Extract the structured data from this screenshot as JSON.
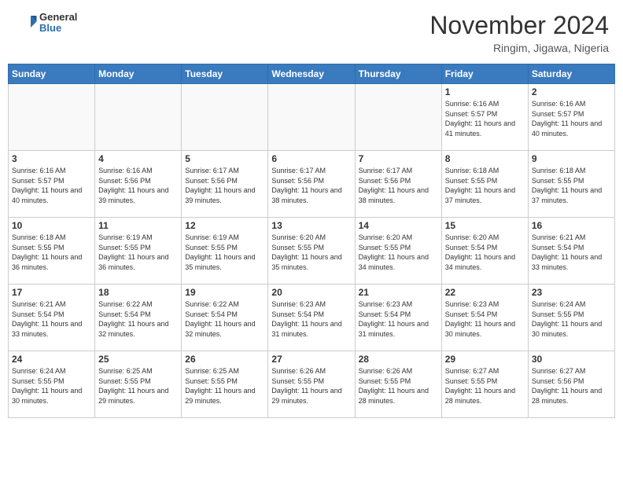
{
  "header": {
    "logo": {
      "general": "General",
      "blue": "Blue"
    },
    "title": "November 2024",
    "location": "Ringim, Jigawa, Nigeria"
  },
  "calendar": {
    "days_of_week": [
      "Sunday",
      "Monday",
      "Tuesday",
      "Wednesday",
      "Thursday",
      "Friday",
      "Saturday"
    ],
    "weeks": [
      [
        {
          "day": "",
          "empty": true
        },
        {
          "day": "",
          "empty": true
        },
        {
          "day": "",
          "empty": true
        },
        {
          "day": "",
          "empty": true
        },
        {
          "day": "",
          "empty": true
        },
        {
          "day": "1",
          "sunrise": "6:16 AM",
          "sunset": "5:57 PM",
          "daylight": "11 hours and 41 minutes."
        },
        {
          "day": "2",
          "sunrise": "6:16 AM",
          "sunset": "5:57 PM",
          "daylight": "11 hours and 40 minutes."
        }
      ],
      [
        {
          "day": "3",
          "sunrise": "6:16 AM",
          "sunset": "5:57 PM",
          "daylight": "11 hours and 40 minutes."
        },
        {
          "day": "4",
          "sunrise": "6:16 AM",
          "sunset": "5:56 PM",
          "daylight": "11 hours and 39 minutes."
        },
        {
          "day": "5",
          "sunrise": "6:17 AM",
          "sunset": "5:56 PM",
          "daylight": "11 hours and 39 minutes."
        },
        {
          "day": "6",
          "sunrise": "6:17 AM",
          "sunset": "5:56 PM",
          "daylight": "11 hours and 38 minutes."
        },
        {
          "day": "7",
          "sunrise": "6:17 AM",
          "sunset": "5:56 PM",
          "daylight": "11 hours and 38 minutes."
        },
        {
          "day": "8",
          "sunrise": "6:18 AM",
          "sunset": "5:55 PM",
          "daylight": "11 hours and 37 minutes."
        },
        {
          "day": "9",
          "sunrise": "6:18 AM",
          "sunset": "5:55 PM",
          "daylight": "11 hours and 37 minutes."
        }
      ],
      [
        {
          "day": "10",
          "sunrise": "6:18 AM",
          "sunset": "5:55 PM",
          "daylight": "11 hours and 36 minutes."
        },
        {
          "day": "11",
          "sunrise": "6:19 AM",
          "sunset": "5:55 PM",
          "daylight": "11 hours and 36 minutes."
        },
        {
          "day": "12",
          "sunrise": "6:19 AM",
          "sunset": "5:55 PM",
          "daylight": "11 hours and 35 minutes."
        },
        {
          "day": "13",
          "sunrise": "6:20 AM",
          "sunset": "5:55 PM",
          "daylight": "11 hours and 35 minutes."
        },
        {
          "day": "14",
          "sunrise": "6:20 AM",
          "sunset": "5:55 PM",
          "daylight": "11 hours and 34 minutes."
        },
        {
          "day": "15",
          "sunrise": "6:20 AM",
          "sunset": "5:54 PM",
          "daylight": "11 hours and 34 minutes."
        },
        {
          "day": "16",
          "sunrise": "6:21 AM",
          "sunset": "5:54 PM",
          "daylight": "11 hours and 33 minutes."
        }
      ],
      [
        {
          "day": "17",
          "sunrise": "6:21 AM",
          "sunset": "5:54 PM",
          "daylight": "11 hours and 33 minutes."
        },
        {
          "day": "18",
          "sunrise": "6:22 AM",
          "sunset": "5:54 PM",
          "daylight": "11 hours and 32 minutes."
        },
        {
          "day": "19",
          "sunrise": "6:22 AM",
          "sunset": "5:54 PM",
          "daylight": "11 hours and 32 minutes."
        },
        {
          "day": "20",
          "sunrise": "6:23 AM",
          "sunset": "5:54 PM",
          "daylight": "11 hours and 31 minutes."
        },
        {
          "day": "21",
          "sunrise": "6:23 AM",
          "sunset": "5:54 PM",
          "daylight": "11 hours and 31 minutes."
        },
        {
          "day": "22",
          "sunrise": "6:23 AM",
          "sunset": "5:54 PM",
          "daylight": "11 hours and 30 minutes."
        },
        {
          "day": "23",
          "sunrise": "6:24 AM",
          "sunset": "5:55 PM",
          "daylight": "11 hours and 30 minutes."
        }
      ],
      [
        {
          "day": "24",
          "sunrise": "6:24 AM",
          "sunset": "5:55 PM",
          "daylight": "11 hours and 30 minutes."
        },
        {
          "day": "25",
          "sunrise": "6:25 AM",
          "sunset": "5:55 PM",
          "daylight": "11 hours and 29 minutes."
        },
        {
          "day": "26",
          "sunrise": "6:25 AM",
          "sunset": "5:55 PM",
          "daylight": "11 hours and 29 minutes."
        },
        {
          "day": "27",
          "sunrise": "6:26 AM",
          "sunset": "5:55 PM",
          "daylight": "11 hours and 29 minutes."
        },
        {
          "day": "28",
          "sunrise": "6:26 AM",
          "sunset": "5:55 PM",
          "daylight": "11 hours and 28 minutes."
        },
        {
          "day": "29",
          "sunrise": "6:27 AM",
          "sunset": "5:55 PM",
          "daylight": "11 hours and 28 minutes."
        },
        {
          "day": "30",
          "sunrise": "6:27 AM",
          "sunset": "5:56 PM",
          "daylight": "11 hours and 28 minutes."
        }
      ]
    ]
  }
}
